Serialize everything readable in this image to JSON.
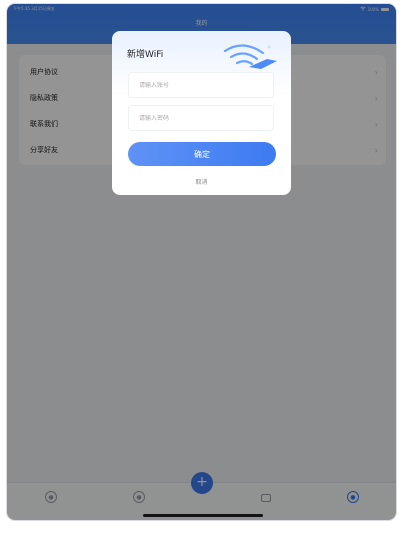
{
  "status": {
    "time": "下午5:35  3月15日周五",
    "battery": "100%"
  },
  "nav": {
    "title": "我的"
  },
  "menu": {
    "items": [
      {
        "label": "用户协议"
      },
      {
        "label": "隐私政策"
      },
      {
        "label": "联系我们"
      },
      {
        "label": "分享好友"
      }
    ]
  },
  "tabbar": {
    "fab_symbol": "+"
  },
  "dialog": {
    "title": "新增WiFi",
    "account_placeholder": "请输入账号",
    "password_placeholder": "请输入密码",
    "confirm_label": "确定",
    "cancel_label": "取消"
  },
  "colors": {
    "primary": "#3f7af1",
    "overlay": "rgba(0,0,0,0.42)"
  }
}
